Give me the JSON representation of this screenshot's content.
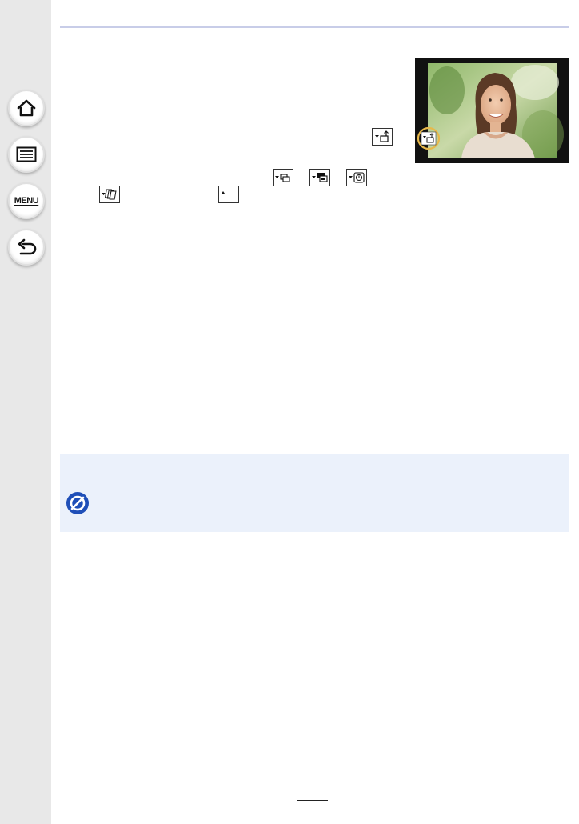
{
  "sidebar": {
    "items": [
      {
        "icon": "home-icon"
      },
      {
        "icon": "list-icon"
      },
      {
        "label": "MENU"
      },
      {
        "icon": "back-arrow-icon"
      }
    ]
  },
  "colors": {
    "sidebar_bg": "#e8e8e8",
    "rule": "#c8cde8",
    "note_bg": "#ebf1fb",
    "note_icon": "#1f4fb8",
    "highlight_ring": "#e8b84a"
  },
  "inline_icons": [
    "drive-mode-single-icon",
    "burst-icon",
    "burst-h-icon",
    "self-timer-icon",
    "bracket-icon",
    "small-triangle-icon"
  ],
  "note": {
    "icon": "not-available-icon"
  }
}
